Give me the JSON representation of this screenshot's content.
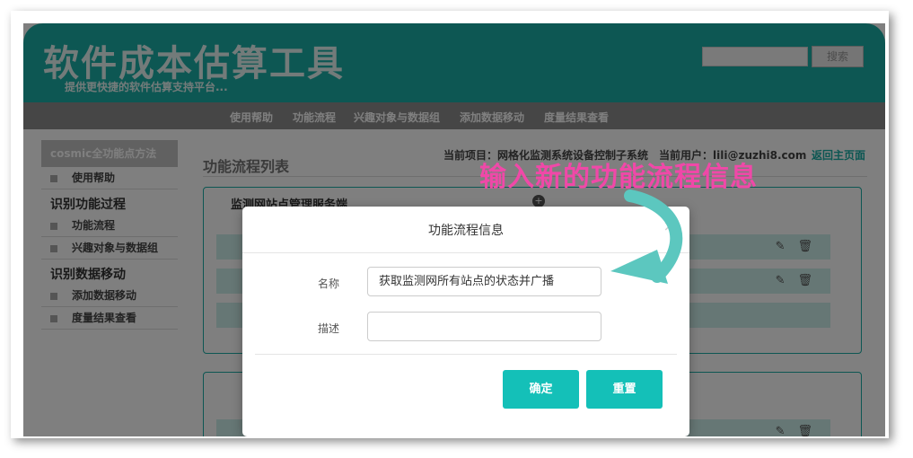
{
  "header": {
    "title": "软件成本估算工具",
    "subtitle": "提供更快捷的软件估算支持平台...",
    "search_button": "搜索"
  },
  "nav": {
    "items": [
      "使用帮助",
      "功能流程",
      "兴趣对象与数据组",
      "添加数据移动",
      "度量结果查看"
    ]
  },
  "sidebar": {
    "heading": "cosmic全功能点方法",
    "help": "使用帮助",
    "group1": "识别功能过程",
    "group1_items": [
      "功能流程",
      "兴趣对象与数据组"
    ],
    "group2": "识别数据移动",
    "group2_items": [
      "添加数据移动",
      "度量结果查看"
    ]
  },
  "content": {
    "title": "功能流程列表",
    "project_info": "当前项目：网格化监测系统设备控制子系统　当前用户：lili@zuzhi8.com",
    "back_link": "返回主页面",
    "panel1_title": "监测网站点管理服务端"
  },
  "modal": {
    "title": "功能流程信息",
    "close": "×",
    "name_label": "名称",
    "name_value": "获取监测网所有站点的状态并广播",
    "desc_label": "描述",
    "desc_value": "",
    "confirm": "确定",
    "reset": "重置"
  },
  "annotation": {
    "text": "输入新的功能流程信息",
    "color": "#f048a8"
  },
  "colors": {
    "accent": "#1aaea6",
    "button": "#14c0b8"
  }
}
